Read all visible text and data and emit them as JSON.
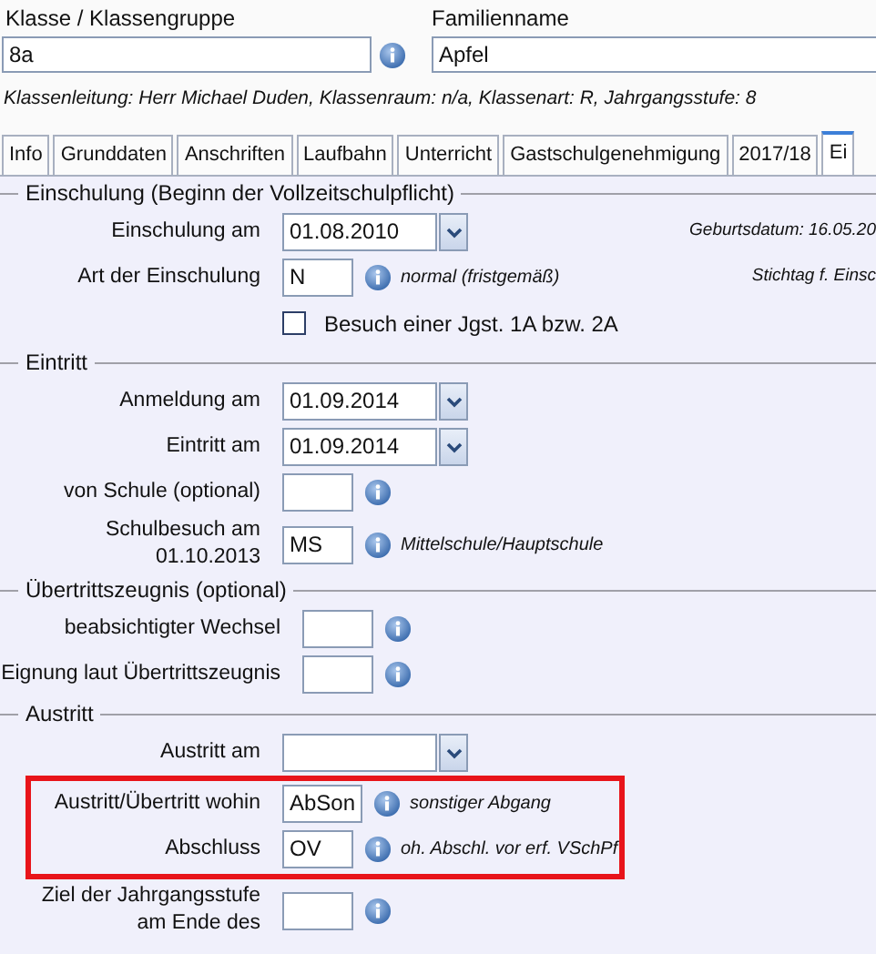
{
  "header": {
    "class_label": "Klasse / Klassengruppe",
    "class_value": "8a",
    "family_label": "Familienname",
    "family_value": "Apfel",
    "info_line": "Klassenleitung: Herr Michael Duden, Klassenraum: n/a, Klassenart: R, Jahrgangsstufe: 8"
  },
  "tabs": [
    {
      "label": "Info",
      "selected": false
    },
    {
      "label": "Grunddaten",
      "selected": false
    },
    {
      "label": "Anschriften",
      "selected": false
    },
    {
      "label": "Laufbahn",
      "selected": false
    },
    {
      "label": "Unterricht",
      "selected": false
    },
    {
      "label": "Gastschulgenehmigung",
      "selected": false
    },
    {
      "label": "2017/18",
      "selected": false
    },
    {
      "label": "Ei",
      "selected": true
    }
  ],
  "sections": [
    {
      "title": "Einschulung (Beginn der Vollzeitschulpflicht)",
      "rows": [
        {
          "kind": "date",
          "label": "Einschulung am",
          "value": "01.08.2010",
          "side_note": "Geburtsdatum: 16.05.20"
        },
        {
          "kind": "code",
          "label": "Art der Einschulung",
          "value": "N",
          "note": "normal (fristgemäß)",
          "side_note": "Stichtag f. Einsc"
        },
        {
          "kind": "checkbox",
          "label": "Besuch einer Jgst. 1A bzw. 2A",
          "checked": false
        }
      ]
    },
    {
      "title": "Eintritt",
      "rows": [
        {
          "kind": "date",
          "label": "Anmeldung am",
          "value": "01.09.2014"
        },
        {
          "kind": "date",
          "label": "Eintritt am",
          "value": "01.09.2014"
        },
        {
          "kind": "code",
          "label": "von Schule (optional)",
          "value": ""
        },
        {
          "kind": "code",
          "label": "Schulbesuch am\n01.10.2013",
          "value": "MS",
          "note": "Mittelschule/Hauptschule"
        }
      ]
    },
    {
      "title": "Übertrittszeugnis (optional)",
      "rows": [
        {
          "kind": "code",
          "label": "beabsichtigter Wechsel",
          "value": ""
        },
        {
          "kind": "code",
          "label": "Eignung laut Übertrittszeugnis",
          "value": ""
        }
      ]
    },
    {
      "title": "Austritt",
      "rows": [
        {
          "kind": "date",
          "label": "Austritt am",
          "value": ""
        },
        {
          "kind": "code",
          "label": "Austritt/Übertritt wohin",
          "value": "AbSon",
          "note": "sonstiger Abgang",
          "highlighted": true
        },
        {
          "kind": "code",
          "label": "Abschluss",
          "value": "OV",
          "note": "oh. Abschl. vor erf. VSchPf",
          "highlighted": true
        },
        {
          "kind": "code",
          "label": "Ziel der Jahrgangsstufe\nam Ende des",
          "value": ""
        }
      ]
    }
  ]
}
